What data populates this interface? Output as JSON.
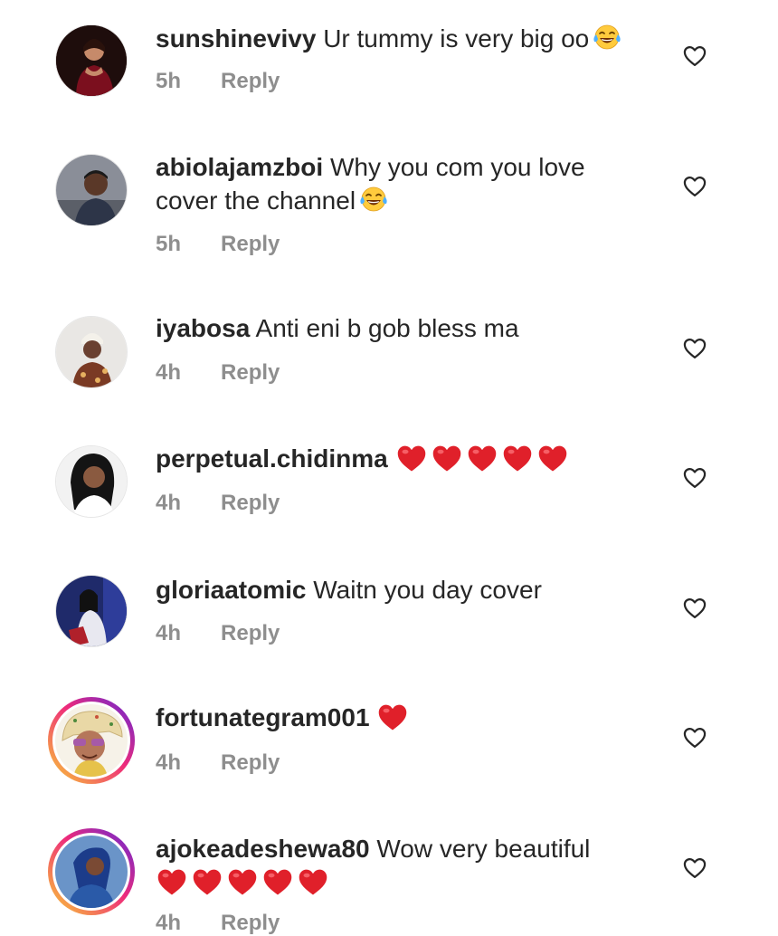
{
  "comments": [
    {
      "username": "sunshinevivy",
      "text": "Ur tummy is very big oo",
      "time": "5h",
      "reply": "Reply"
    },
    {
      "username": "abiolajamzboi",
      "text": "Why you com you love",
      "text2": "cover the channel",
      "time": "5h",
      "reply": "Reply"
    },
    {
      "username": "iyabosa",
      "text": "Anti eni b gob bless ma",
      "time": "4h",
      "reply": "Reply"
    },
    {
      "username": "perpetual.chidinma",
      "text": "",
      "time": "4h",
      "reply": "Reply"
    },
    {
      "username": "gloriaatomic",
      "text": "Waitn you day cover",
      "time": "4h",
      "reply": "Reply"
    },
    {
      "username": "fortunategram001",
      "text": "",
      "time": "4h",
      "reply": "Reply"
    },
    {
      "username": "ajokeadeshewa80",
      "text": "Wow  very beautiful",
      "time": "4h",
      "reply": "Reply"
    }
  ],
  "icons": {
    "like": "heart-outline-icon",
    "emoji_laugh": "tears-of-joy-emoji",
    "emoji_heart": "red-heart-emoji"
  },
  "colors": {
    "heart_red": "#e0202a",
    "meta_grey": "#8e8e8e",
    "text": "#262626",
    "story_ring": [
      "#f9ce34",
      "#ee2a7b",
      "#6228d7"
    ]
  }
}
